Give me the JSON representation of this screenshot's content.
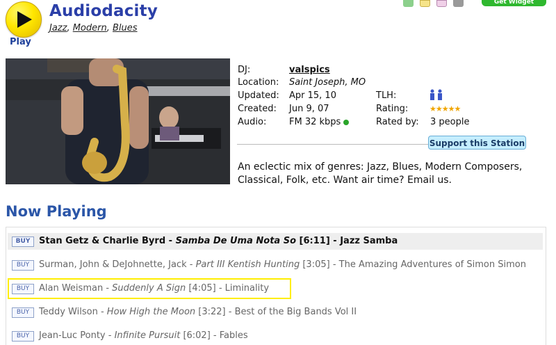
{
  "header": {
    "station_name": "Audiodacity",
    "play_label": "Play",
    "genres": [
      "Jazz",
      "Modern",
      "Blues"
    ],
    "widget_label": "Get Widget"
  },
  "info": {
    "dj_label": "DJ:",
    "dj_value": "valspics",
    "location_label": "Location:",
    "location_value": "Saint Joseph, MO",
    "updated_label": "Updated:",
    "updated_value": "Apr 15, 10",
    "created_label": "Created:",
    "created_value": "Jun 9, 07",
    "audio_label": "Audio:",
    "audio_value": "FM 32 kbps",
    "tlh_label": "TLH:",
    "rating_label": "Rating:",
    "rating_stars": 5,
    "rated_by_label": "Rated by:",
    "rated_by_value": "3 people",
    "support_button": "Support this Station"
  },
  "description": "An eclectic mix of genres: Jazz, Blues, Modern Composers, Classical, Folk, etc. Want air time? Email us.",
  "now_playing": {
    "heading": "Now Playing",
    "buy_label": "BUY",
    "tracks": [
      {
        "artist": "Stan Getz & Charlie Byrd",
        "title": "Samba De Uma Nota So",
        "duration": "[6:11]",
        "album": "Jazz Samba"
      },
      {
        "artist": "Surman, John & DeJohnette, Jack",
        "title": "Part III Kentish Hunting",
        "duration": "[3:05]",
        "album": "The Amazing Adventures of Simon Simon"
      },
      {
        "artist": "Alan Weisman",
        "title": "Suddenly A Sign",
        "duration": "[4:05]",
        "album": "Liminality"
      },
      {
        "artist": "Teddy Wilson",
        "title": "How High the Moon",
        "duration": "[3:22]",
        "album": "Best of the Big Bands Vol II"
      },
      {
        "artist": "Jean-Luc Ponty",
        "title": "Infinite Pursuit",
        "duration": "[6:02]",
        "album": "Fables"
      }
    ]
  },
  "colors": {
    "title_blue": "#2b3fa8",
    "heading_blue": "#2b56a8",
    "play_yellow": "#ffe600",
    "status_green": "#2aa52a",
    "highlight_yellow": "#ffee00"
  }
}
